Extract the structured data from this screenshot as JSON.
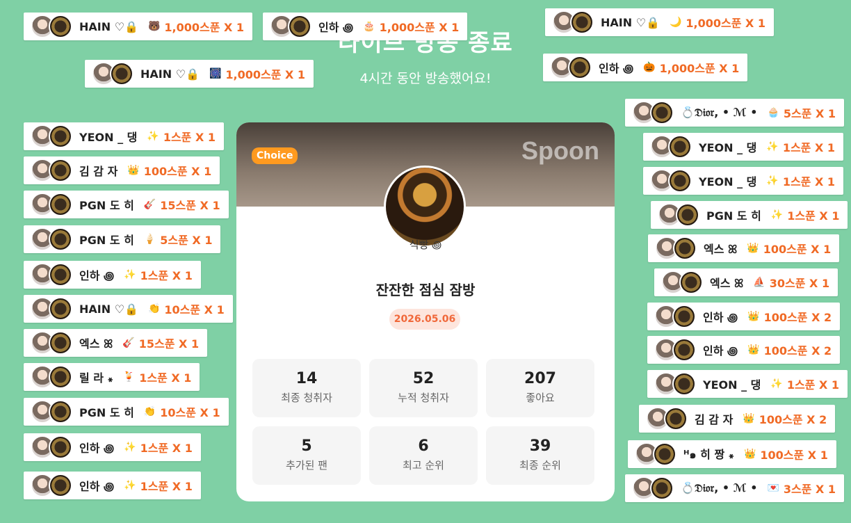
{
  "header": {
    "title": "라이브 방송 종료",
    "subtitle": "4시간 동안 방송했어요!"
  },
  "card": {
    "badge": "Choice",
    "watermark": "Spoon",
    "host_name": "식빵 ꩜",
    "room_title": "잔잔한 점심 잠방",
    "date": "2026.05.06",
    "stats": [
      {
        "value": "14",
        "label": "최종 청취자"
      },
      {
        "value": "52",
        "label": "누적 청취자"
      },
      {
        "value": "207",
        "label": "좋아요"
      },
      {
        "value": "5",
        "label": "추가된 팬"
      },
      {
        "value": "6",
        "label": "최고 순위"
      },
      {
        "value": "39",
        "label": "최종 순위"
      }
    ]
  },
  "gifts": [
    {
      "user": "HAIN ♡🔒",
      "icon": "🐻",
      "amount": "1,000스푼 X 1"
    },
    {
      "user": "인하 ꩜",
      "icon": "🎂",
      "amount": "1,000스푼 X 1"
    },
    {
      "user": "HAIN ♡🔒",
      "icon": "🌙",
      "amount": "1,000스푼 X 1"
    },
    {
      "user": "HAIN ♡🔒",
      "icon": "🎆",
      "amount": "1,000스푼 X 1"
    },
    {
      "user": "인하 ꩜",
      "icon": "🎃",
      "amount": "1,000스푼 X 1"
    },
    {
      "user": "YEON _ 댕",
      "icon": "✨",
      "amount": "1스푼 X 1"
    },
    {
      "user": "김 감 자",
      "icon": "👑",
      "amount": "100스푼 X 1"
    },
    {
      "user": "PGN 도 히",
      "icon": "🎸",
      "amount": "15스푼 X 1"
    },
    {
      "user": "PGN 도 히",
      "icon": "🍦",
      "amount": "5스푼 X 1"
    },
    {
      "user": "인하 ꩜",
      "icon": "✨",
      "amount": "1스푼 X 1"
    },
    {
      "user": "HAIN ♡🔒",
      "icon": "👏",
      "amount": "10스푼 X 1"
    },
    {
      "user": "엑스 ꕤ",
      "icon": "🎸",
      "amount": "15스푼 X 1"
    },
    {
      "user": "릴 라 ꘎",
      "icon": "🍹",
      "amount": "1스푼 X 1"
    },
    {
      "user": "PGN 도 히",
      "icon": "👏",
      "amount": "10스푼 X 1"
    },
    {
      "user": "인하 ꩜",
      "icon": "✨",
      "amount": "1스푼 X 1"
    },
    {
      "user": "인하 ꩜",
      "icon": "✨",
      "amount": "1스푼 X 1"
    },
    {
      "user": "💍𝔇𝔦𝔬𝔯, • ℳ •",
      "icon": "🧁",
      "amount": "5스푼 X 1"
    },
    {
      "user": "YEON _ 댕",
      "icon": "✨",
      "amount": "1스푼 X 1"
    },
    {
      "user": "YEON _ 댕",
      "icon": "✨",
      "amount": "1스푼 X 1"
    },
    {
      "user": "PGN 도 히",
      "icon": "✨",
      "amount": "1스푼 X 1"
    },
    {
      "user": "엑스 ꕤ",
      "icon": "👑",
      "amount": "100스푼 X 1"
    },
    {
      "user": "엑스 ꕤ",
      "icon": "⛵",
      "amount": "30스푼 X 1"
    },
    {
      "user": "인하 ꩜",
      "icon": "👑",
      "amount": "100스푼 X 2"
    },
    {
      "user": "인하 ꩜",
      "icon": "👑",
      "amount": "100스푼 X 2"
    },
    {
      "user": "YEON _ 댕",
      "icon": "✨",
      "amount": "1스푼 X 1"
    },
    {
      "user": "김 감 자",
      "icon": "👑",
      "amount": "100스푼 X 2"
    },
    {
      "user": "ᴴ๑ 히 짱 ꘎",
      "icon": "👑",
      "amount": "100스푼 X 1"
    },
    {
      "user": "💍𝔇𝔦𝔬𝔯, • ℳ •",
      "icon": "💌",
      "amount": "3스푼 X 1"
    }
  ],
  "colors": {
    "background": "#7fd0a5",
    "accent": "#f06a25",
    "badge": "#ff9a1f"
  }
}
